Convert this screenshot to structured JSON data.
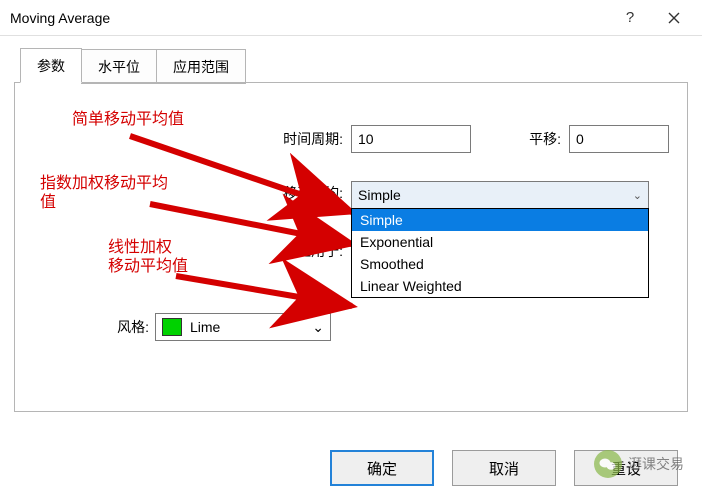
{
  "window": {
    "title": "Moving Average"
  },
  "tabs": {
    "t0": "参数",
    "t1": "水平位",
    "t2": "应用范围"
  },
  "labels": {
    "period": "时间周期:",
    "shift": "平移:",
    "method": "移动平均:",
    "apply": "应用于:",
    "style": "风格:"
  },
  "fields": {
    "period_value": "10",
    "shift_value": "0",
    "method_selected": "Simple",
    "color_name": "Lime"
  },
  "dropdown": {
    "opt0": "Simple",
    "opt1": "Exponential",
    "opt2": "Smoothed",
    "opt3": "Linear Weighted"
  },
  "buttons": {
    "ok": "确定",
    "cancel": "取消",
    "reset": "重设"
  },
  "annotations": {
    "a1": "简单移动平均值",
    "a2_l1": "指数加权移动平均",
    "a2_l2": "值",
    "a3_l1": "线性加权",
    "a3_l2": "移动平均值"
  },
  "watermark": {
    "text": "湃课交易"
  },
  "colors": {
    "accent": "#0a7de3",
    "annotation": "#d40000",
    "swatch": "#00d200"
  },
  "chart_data": null
}
